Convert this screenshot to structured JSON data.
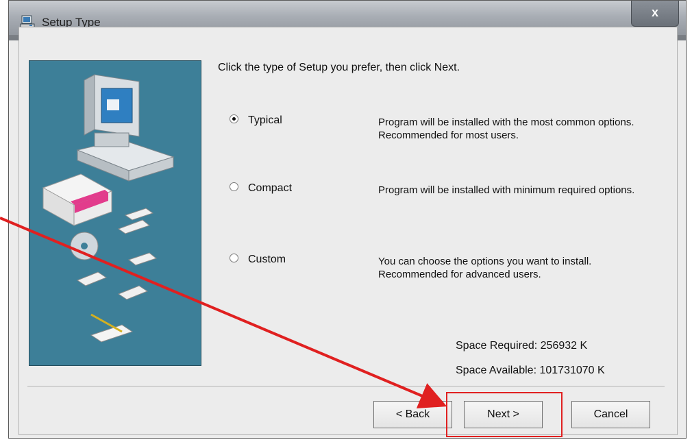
{
  "window": {
    "title": "Setup Type",
    "close_label": "x"
  },
  "instruction": "Click the type of Setup you prefer, then click Next.",
  "options": [
    {
      "label": "Typical",
      "selected": true,
      "description": "Program will be installed with the most common options. Recommended for most users."
    },
    {
      "label": "Compact",
      "selected": false,
      "description": "Program will be installed with minimum required options."
    },
    {
      "label": "Custom",
      "selected": false,
      "description": "You can choose the options you want to install. Recommended for advanced users."
    }
  ],
  "space": {
    "required_label": "Space Required:",
    "required_value": "256932 K",
    "available_label": "Space Available:",
    "available_value": "101731070 K"
  },
  "buttons": {
    "back": "< Back",
    "next": "Next >",
    "cancel": "Cancel"
  },
  "colors": {
    "banner": "#3d7f98",
    "annotation": "#e02020"
  }
}
